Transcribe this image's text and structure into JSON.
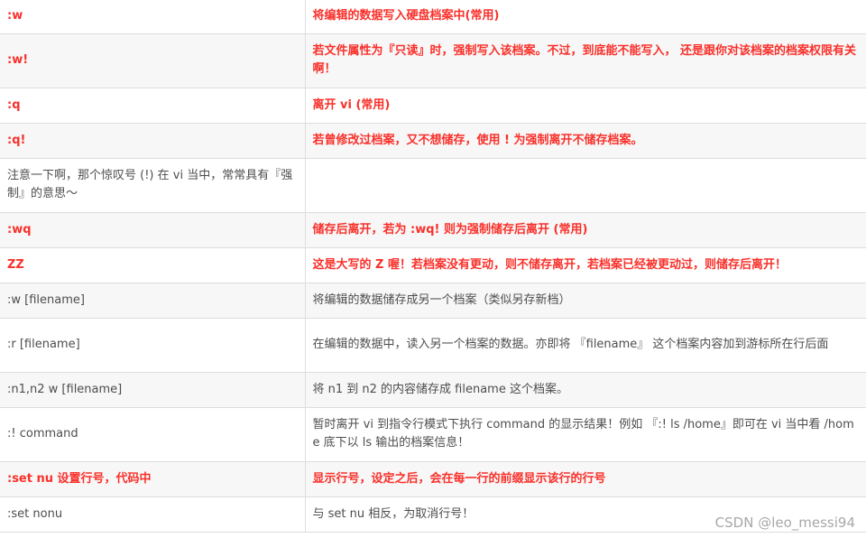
{
  "rows": [
    {
      "cmd": ":w",
      "desc": "将编辑的数据写入硬盘档案中(常用)",
      "cmd_red": true,
      "desc_red": true
    },
    {
      "cmd": ":w!",
      "desc": "若文件属性为『只读』时，强制写入该档案。不过，到底能不能写入， 还是跟你对该档案的档案权限有关啊！",
      "cmd_red": true,
      "desc_red": true
    },
    {
      "cmd": ":q",
      "desc": "离开 vi (常用)",
      "cmd_red": true,
      "desc_red": true
    },
    {
      "cmd": ":q!",
      "desc": "若曾修改过档案，又不想储存，使用 ! 为强制离开不储存档案。",
      "cmd_red": true,
      "desc_red": true
    },
    {
      "cmd": "注意一下啊，那个惊叹号 (!) 在 vi 当中，常常具有『强制』的意思～",
      "desc": "",
      "cmd_red": false,
      "desc_red": false
    },
    {
      "cmd": ":wq",
      "desc": "储存后离开，若为 :wq! 则为强制储存后离开 (常用)",
      "cmd_red": true,
      "desc_red": true
    },
    {
      "cmd": "ZZ",
      "desc": "这是大写的 Z 喔！若档案没有更动，则不储存离开，若档案已经被更动过，则储存后离开！",
      "cmd_red": true,
      "desc_red": true
    },
    {
      "cmd": ":w [filename]",
      "desc": "将编辑的数据储存成另一个档案（类似另存新档）",
      "cmd_red": false,
      "desc_red": false
    },
    {
      "cmd": ":r [filename]",
      "desc": "在编辑的数据中，读入另一个档案的数据。亦即将 『filename』 这个档案内容加到游标所在行后面",
      "cmd_red": false,
      "desc_red": false
    },
    {
      "cmd": ":n1,n2 w [filename]",
      "desc": "将 n1 到 n2 的内容储存成 filename 这个档案。",
      "cmd_red": false,
      "desc_red": false
    },
    {
      "cmd": ":! command",
      "desc": "暂时离开 vi 到指令行模式下执行 command 的显示结果！例如 『:! ls /home』即可在 vi 当中看 /home 底下以 ls 输出的档案信息！",
      "cmd_red": false,
      "desc_red": false
    },
    {
      "cmd": ":set nu 设置行号，代码中",
      "desc": "显示行号，设定之后，会在每一行的前缀显示该行的行号",
      "cmd_red": true,
      "desc_red": true
    },
    {
      "cmd": ":set nonu",
      "desc": "与 set nu 相反，为取消行号！",
      "cmd_red": false,
      "desc_red": false
    }
  ],
  "watermark": "CSDN @leo_messi94",
  "colors": {
    "highlight": "#f9302a",
    "text": "#4d4d4d",
    "stripe": "#f7f7f7",
    "border": "#dddddd"
  }
}
